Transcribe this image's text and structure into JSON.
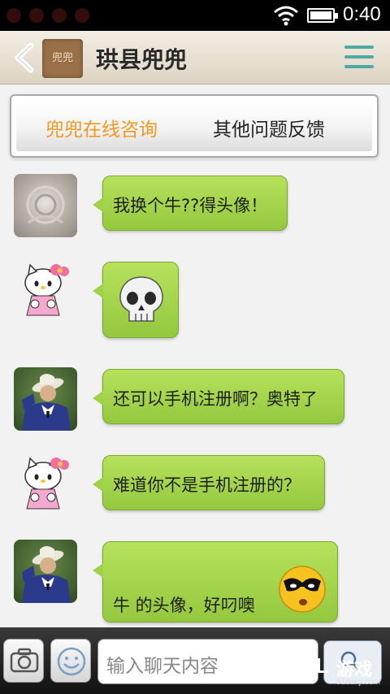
{
  "status_bar": {
    "time": "0:40"
  },
  "header": {
    "title": "珙县兜兜",
    "logo_text": "兜兜"
  },
  "tabs": [
    {
      "label": "兜兜在线咨询",
      "active": true
    },
    {
      "label": "其他问题反馈",
      "active": false
    }
  ],
  "messages": [
    {
      "avatar": "stone-carving",
      "text": "我换个牛??得头像！"
    },
    {
      "avatar": "hello-kitty",
      "text": "",
      "emoji": "skull"
    },
    {
      "avatar": "man-in-hat",
      "text": "还可以手机注册啊？奥特了"
    },
    {
      "avatar": "hello-kitty",
      "text": "难道你不是手机注册的？"
    },
    {
      "avatar": "man-in-hat",
      "text": "牛 的头像，好叼噢",
      "emoji": "cool-face"
    }
  ],
  "composer": {
    "placeholder": "输入聊天内容"
  },
  "watermark": {
    "logo": "9L",
    "name": "游戏",
    "site": "91danji.com"
  },
  "colors": {
    "bubble": "#a6d84c",
    "active_tab": "#f5961e",
    "menu_icon": "#4fa9a4"
  }
}
